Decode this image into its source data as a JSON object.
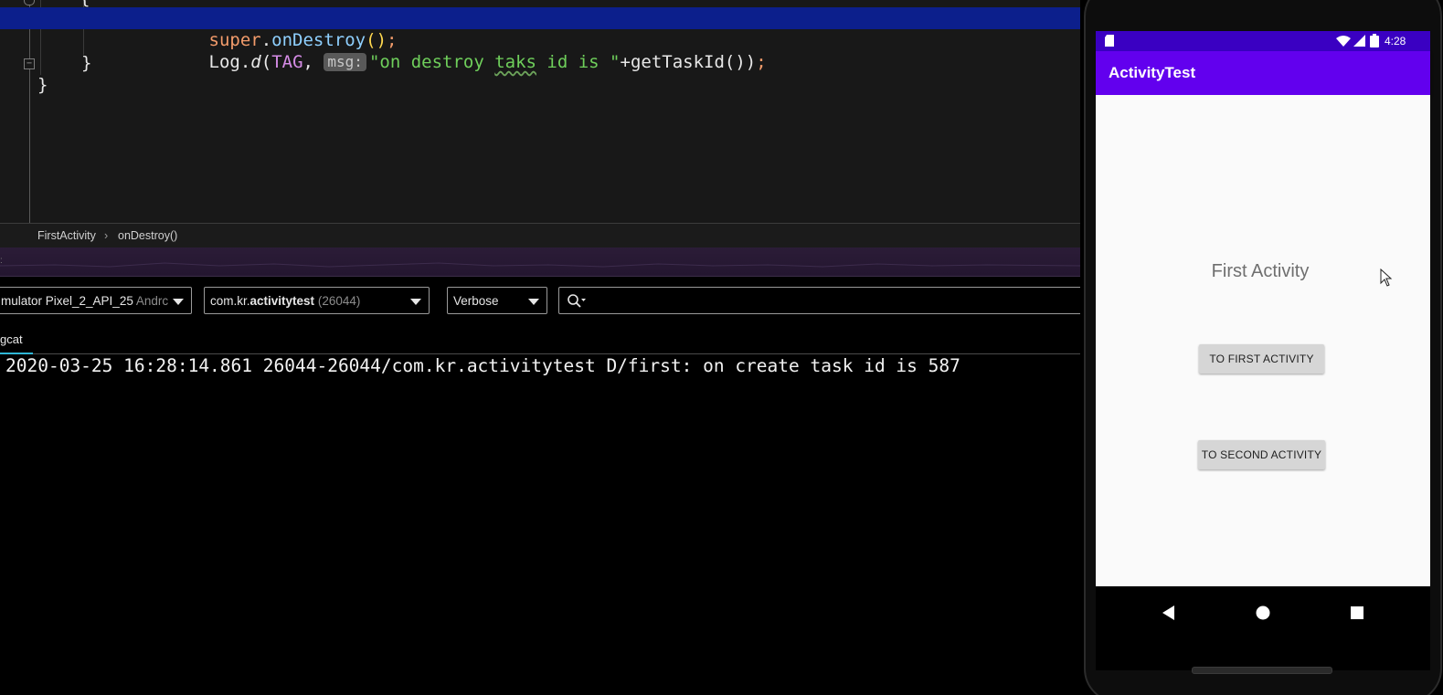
{
  "editor": {
    "lines": [
      {
        "kw": "super",
        "dot": ".",
        "meth": "onDestroy",
        "paren": "()",
        "semi": ";"
      },
      {
        "cls": "Log.",
        "meth_italic": "d",
        "open": "(",
        "field": "TAG",
        "comma": ", ",
        "hint": "msg:",
        "string_pre": "\"on destroy ",
        "string_sq": "taks",
        "string_post": " id is \"",
        "rest": "+getTaskId())",
        "semi": ";"
      },
      {
        "text": "}"
      },
      {
        "text": "}"
      }
    ],
    "top_partial": "{"
  },
  "breadcrumbs": {
    "class_name": "FirstActivity",
    "separator": "›",
    "method": "onDestroy()"
  },
  "logcat": {
    "device_combo": {
      "name": "mulator Pixel_2_API_25",
      "suffix": "Andrc"
    },
    "process_combo": {
      "prefix": "com.kr.",
      "bold": "activitytest",
      "pid": "(26044)"
    },
    "level_combo": {
      "value": "Verbose"
    },
    "search": {
      "icon": "search-icon",
      "placeholder": ""
    },
    "tab_label": "gcat",
    "lines": [
      "2020-03-25 16:28:14.861 26044-26044/com.kr.activitytest D/first: on create task id is 587"
    ]
  },
  "emulator": {
    "status_time": "4:28",
    "app_title": "ActivityTest",
    "center_text": "First Activity",
    "buttons": [
      "TO FIRST ACTIVITY",
      "TO SECOND ACTIVITY"
    ],
    "colors": {
      "primary": "#6200ee",
      "primary_dark": "#3a00c2",
      "background": "#fafafa"
    },
    "nav_icons": [
      "back-icon",
      "home-icon",
      "recents-icon"
    ]
  }
}
